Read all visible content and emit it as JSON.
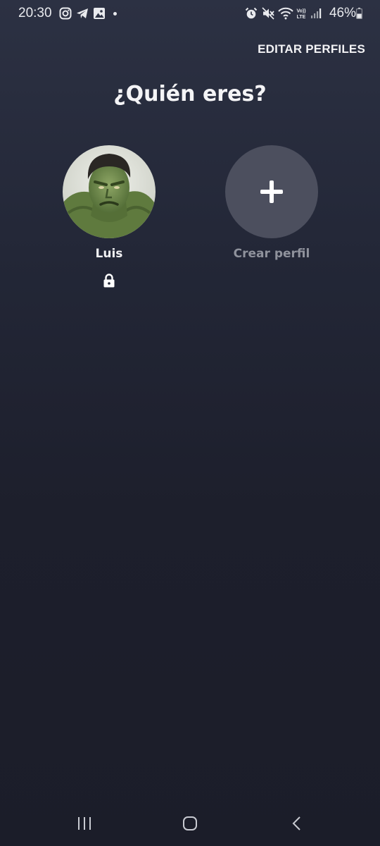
{
  "status_bar": {
    "time": "20:30",
    "battery": "46%",
    "left_icons": [
      "instagram-icon",
      "telegram-icon",
      "gallery-icon",
      "dot-icon"
    ],
    "right_icons": [
      "alarm-icon",
      "mute-icon",
      "wifi-icon",
      "volte-icon",
      "signal-icon",
      "battery-icon"
    ]
  },
  "header": {
    "edit_profiles": "EDITAR PERFILES",
    "title": "¿Quién eres?"
  },
  "profiles": [
    {
      "name": "Luis",
      "locked": true,
      "avatar": "hulk-avatar"
    },
    {
      "name": "Crear perfil",
      "action": "add",
      "icon": "plus-icon"
    }
  ],
  "nav_bar": {
    "buttons": [
      "recents-icon",
      "home-icon",
      "back-icon"
    ]
  },
  "colors": {
    "background_top": "#2c3143",
    "background_bottom": "#1b1d29",
    "add_circle": "#4c4f5e",
    "muted_text": "#8f929c"
  }
}
